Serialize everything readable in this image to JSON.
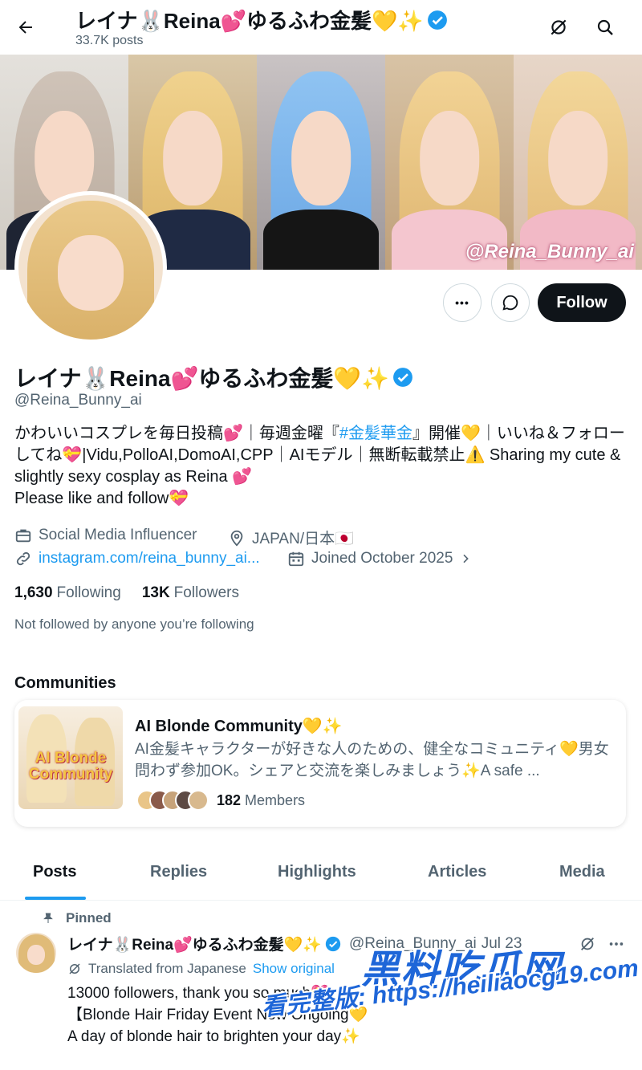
{
  "header": {
    "title": "レイナ🐰Reina💕ゆるふわ金髪💛✨",
    "posts_count": "33.7K posts"
  },
  "banner": {
    "watermark": "@Reina_Bunny_ai"
  },
  "actions": {
    "more_label": "•••",
    "follow_label": "Follow"
  },
  "profile": {
    "name": "レイナ🐰Reina💕ゆるふわ金髪💛✨",
    "handle": "@Reina_Bunny_ai",
    "bio_part1": "かわいいコスプレを毎日投稿💕｜毎週金曜『",
    "bio_hashtag": "#金髪華金",
    "bio_part2": "』開催💛｜いいね＆フォローしてね💝|Vidu,PolloAI,DomoAI,CPP｜AIモデル｜無断転載禁止⚠️ Sharing my cute & slightly sexy cosplay as Reina 💕",
    "bio_part3": "Please like and follow💝",
    "category": "Social Media Influencer",
    "location": "JAPAN/日本🇯🇵",
    "website": "instagram.com/reina_bunny_ai...",
    "joined": "Joined October 2025",
    "following_count": "1,630",
    "following_label": "Following",
    "followers_count": "13K",
    "followers_label": "Followers",
    "not_followed": "Not followed by anyone you’re following"
  },
  "communities": {
    "heading": "Communities",
    "card": {
      "thumb_text": "AI Blonde Community",
      "name": "AI Blonde Community💛✨",
      "description": "AI金髪キャラクターが好きな人のための、健全なコミュニティ💛男女問わず参加OK。シェアと交流を楽しみましょう✨A safe ...",
      "members_count": "182",
      "members_label": "Members"
    }
  },
  "tabs": [
    "Posts",
    "Replies",
    "Highlights",
    "Articles",
    "Media"
  ],
  "post": {
    "pinned_label": "Pinned",
    "author_name": "レイナ🐰Reina💕ゆるふわ金髪💛✨",
    "author_handle": "@Reina_Bunny_ai",
    "date": "Jul 23",
    "translated_label": "Translated from Japanese",
    "show_original": "Show original",
    "line1": "13000 followers, thank you so much💝",
    "line2": "【Blonde Hair Friday Event Now Ongoing💛",
    "line3": "A day of blonde hair to brighten your day✨"
  },
  "overlay": {
    "site_name": "黑料吃瓜网",
    "site_url": "看完整版: https://heiliaocg19.com"
  },
  "colors": {
    "accent": "#1d9bf0",
    "text": "#0f1419",
    "muted": "#536471"
  }
}
